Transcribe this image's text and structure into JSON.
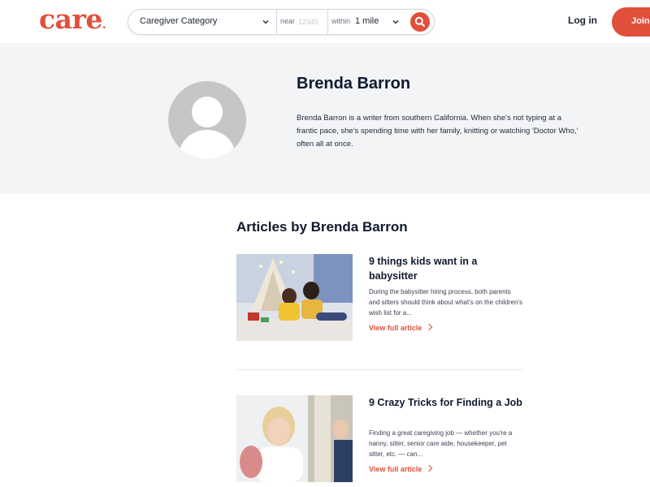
{
  "header": {
    "logo_text": "care",
    "logo_dot": ".",
    "search": {
      "category_label": "Caregiver Category",
      "near_label": "near",
      "zip_placeholder": "12345",
      "within_label": "within",
      "distance_value": "1 mile"
    },
    "login_label": "Log in",
    "join_label": "Join now"
  },
  "profile": {
    "name": "Brenda Barron",
    "bio": "Brenda Barron is a writer from southern California. When she's not typing at a frantic pace, she's spending time with her family, knitting or watching 'Doctor Who,' often all at once."
  },
  "articles": {
    "heading": "Articles by Brenda Barron",
    "items": [
      {
        "title": "9 things kids want in a babysitter",
        "excerpt": "During the babysitter hiring process, both parents and sitters should think about what's on the children's wish list for a...",
        "link_label": "View full article"
      },
      {
        "title": "9 Crazy Tricks for Finding a Job",
        "excerpt": "Finding a great caregiving job — whether you're a nanny, sitter, senior care aide, housekeeper, pet sitter, etc. — can...",
        "link_label": "View full article"
      }
    ]
  },
  "colors": {
    "brand": "#e24f3a",
    "profile_bg": "#f3f4f6",
    "heading_text": "#101a2e"
  },
  "icons": {
    "category_dropdown": "chevron-down-icon",
    "distance_dropdown": "chevron-down-icon",
    "search": "search-icon",
    "avatar": "user-placeholder-icon",
    "article_link": "chevron-right-icon"
  }
}
